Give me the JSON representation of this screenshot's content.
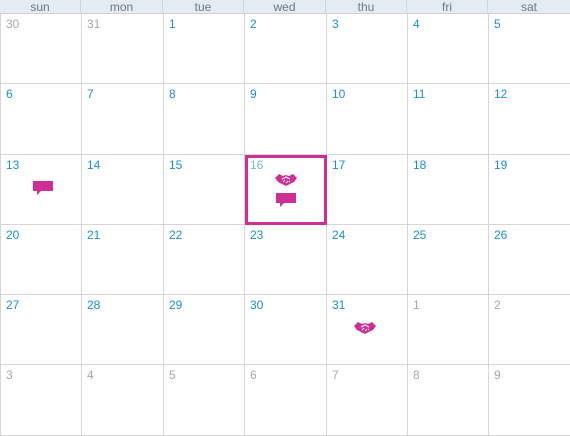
{
  "weekdays": [
    "sun",
    "mon",
    "tue",
    "wed",
    "thu",
    "fri",
    "sat"
  ],
  "weeks": [
    [
      {
        "label": "30",
        "other": true
      },
      {
        "label": "31",
        "other": true
      },
      {
        "label": "1",
        "other": false
      },
      {
        "label": "2",
        "other": false
      },
      {
        "label": "3",
        "other": false
      },
      {
        "label": "4",
        "other": false
      },
      {
        "label": "5",
        "other": false
      }
    ],
    [
      {
        "label": "6",
        "other": false
      },
      {
        "label": "7",
        "other": false
      },
      {
        "label": "8",
        "other": false
      },
      {
        "label": "9",
        "other": false
      },
      {
        "label": "10",
        "other": false
      },
      {
        "label": "11",
        "other": false
      },
      {
        "label": "12",
        "other": false
      }
    ],
    [
      {
        "label": "13",
        "other": false,
        "events": [
          "speech-bubble-icon"
        ]
      },
      {
        "label": "14",
        "other": false
      },
      {
        "label": "15",
        "other": false
      },
      {
        "label": "16",
        "other": false,
        "today": true,
        "events": [
          "handshake-icon",
          "speech-bubble-icon"
        ]
      },
      {
        "label": "17",
        "other": false
      },
      {
        "label": "18",
        "other": false
      },
      {
        "label": "19",
        "other": false
      }
    ],
    [
      {
        "label": "20",
        "other": false
      },
      {
        "label": "21",
        "other": false
      },
      {
        "label": "22",
        "other": false
      },
      {
        "label": "23",
        "other": false
      },
      {
        "label": "24",
        "other": false
      },
      {
        "label": "25",
        "other": false
      },
      {
        "label": "26",
        "other": false
      }
    ],
    [
      {
        "label": "27",
        "other": false
      },
      {
        "label": "28",
        "other": false
      },
      {
        "label": "29",
        "other": false
      },
      {
        "label": "30",
        "other": false
      },
      {
        "label": "31",
        "other": false,
        "events": [
          "handshake-icon"
        ]
      },
      {
        "label": "1",
        "other": true
      },
      {
        "label": "2",
        "other": true
      }
    ],
    [
      {
        "label": "3",
        "other": true
      },
      {
        "label": "4",
        "other": true
      },
      {
        "label": "5",
        "other": true
      },
      {
        "label": "6",
        "other": true
      },
      {
        "label": "7",
        "other": true
      },
      {
        "label": "8",
        "other": true
      },
      {
        "label": "9",
        "other": true
      }
    ]
  ],
  "colors": {
    "accent": "#cf2f95",
    "date_text": "#1d8fc8",
    "other_month_text": "#a8a8a8",
    "header_background": "#e4ebf1",
    "header_text": "#6f7780",
    "grid_line": "#d6d6d6"
  }
}
